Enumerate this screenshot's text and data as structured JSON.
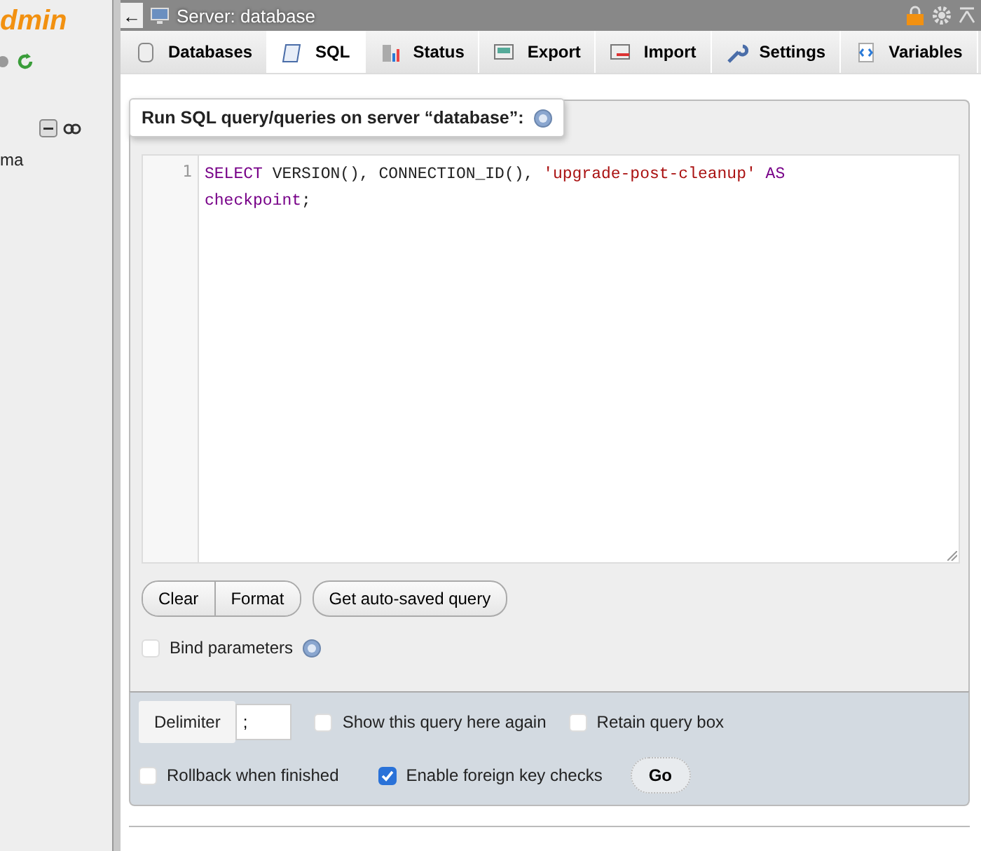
{
  "sidebar": {
    "logo_text": "dmin",
    "items": [
      "ma"
    ]
  },
  "topbar": {
    "back": "←",
    "title": "Server: database"
  },
  "tabs": [
    {
      "label": "Databases",
      "selected": false
    },
    {
      "label": "SQL",
      "selected": true
    },
    {
      "label": "Status",
      "selected": false
    },
    {
      "label": "Export",
      "selected": false
    },
    {
      "label": "Import",
      "selected": false
    },
    {
      "label": "Settings",
      "selected": false
    },
    {
      "label": "Variables",
      "selected": false
    }
  ],
  "query_panel": {
    "legend": "Run SQL query/queries on server “database”:",
    "editor": {
      "line_number": "1",
      "tokens": [
        {
          "kind": "keyword",
          "text": "SELECT"
        },
        {
          "kind": "plain",
          "text": " VERSION(), CONNECTION_ID(), "
        },
        {
          "kind": "string",
          "text": "'upgrade-post-cleanup'"
        },
        {
          "kind": "keyword",
          "text": " AS"
        },
        {
          "kind": "keyword",
          "text": " checkpoint"
        },
        {
          "kind": "plain",
          "text": ";"
        }
      ]
    },
    "buttons": [
      "Clear",
      "Format"
    ],
    "autosave_button": "Get auto-saved query",
    "bind_parameters": {
      "label": "Bind parameters",
      "checked": false
    }
  },
  "options": {
    "delimiter_label": "Delimiter",
    "delimiter_value": ";",
    "checkboxes_row1": [
      {
        "label": "Show this query here again",
        "checked": false
      },
      {
        "label": "Retain query box",
        "checked": false
      }
    ],
    "checkboxes_row2": [
      {
        "label": "Rollback when finished",
        "checked": false
      },
      {
        "label": "Enable foreign key checks",
        "checked": true
      }
    ],
    "go_button": "Go"
  }
}
